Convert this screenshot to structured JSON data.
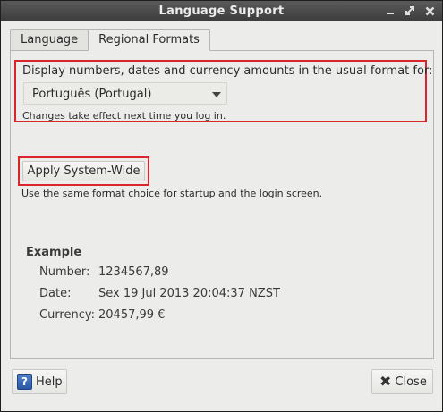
{
  "window": {
    "title": "Language Support"
  },
  "tabs": [
    {
      "label": "Language",
      "active": false
    },
    {
      "label": "Regional Formats",
      "active": true
    }
  ],
  "regional": {
    "prompt": "Display numbers, dates and currency amounts in the usual format for:",
    "selected_format": "Português (Portugal)",
    "note": "Changes take effect next time you log in."
  },
  "system_wide": {
    "button_label": "Apply System-Wide",
    "note": "Use the same format choice for startup and the login screen."
  },
  "example": {
    "heading": "Example",
    "number_label": "Number:",
    "number_value": "1234567,89",
    "date_label": "Date:",
    "date_value": "Sex 19 Jul 2013 20:04:37 NZST",
    "currency_label": "Currency:",
    "currency_value": "20457,99 €"
  },
  "footer": {
    "help_label": "Help",
    "close_label": "Close"
  },
  "icons": {
    "help": "help-icon",
    "close": "close-icon",
    "window_minimize": "minimize-icon",
    "window_maximize": "maximize-icon",
    "window_close": "window-close-icon"
  },
  "colors": {
    "highlight_border": "#d9262b",
    "titlebar": "#4a4a4a",
    "window_bg": "#ececea"
  }
}
